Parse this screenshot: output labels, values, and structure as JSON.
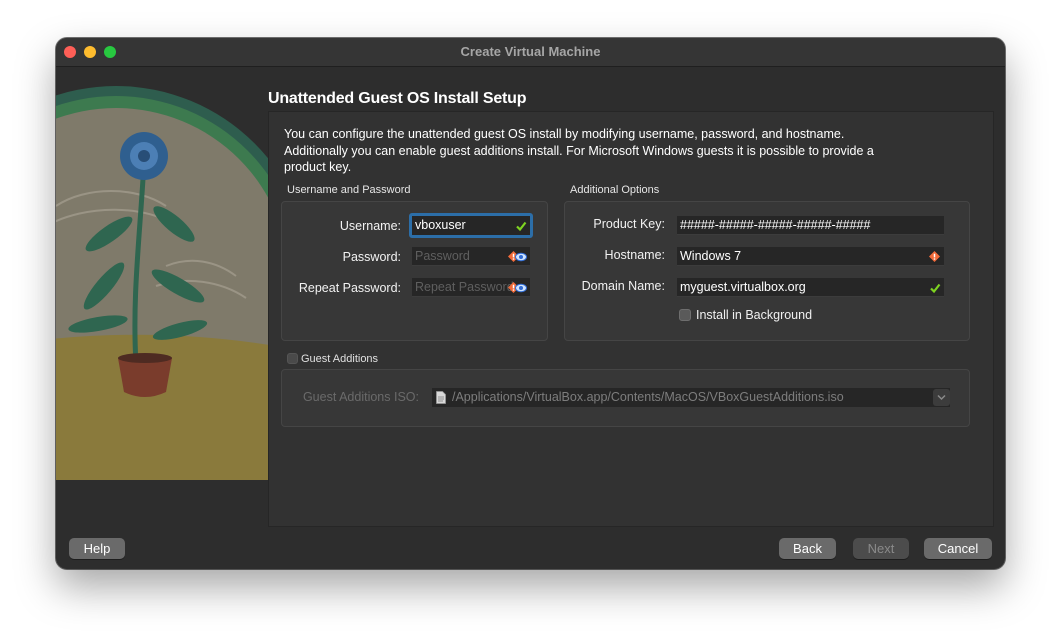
{
  "window": {
    "title": "Create Virtual Machine"
  },
  "page": {
    "title": "Unattended Guest OS Install Setup",
    "description": "You can configure the unattended guest OS install by modifying username, password, and hostname. Additionally you can enable guest additions install. For Microsoft Windows guests it is possible to provide a product key."
  },
  "credentials": {
    "group_label": "Username and Password",
    "username_label": "Username:",
    "username_value": "vboxuser",
    "password_label": "Password:",
    "password_placeholder": "Password",
    "repeat_label": "Repeat Password:",
    "repeat_placeholder": "Repeat Password"
  },
  "options": {
    "group_label": "Additional Options",
    "product_key_label": "Product Key:",
    "product_key_value": "#####-#####-#####-#####-#####",
    "hostname_label": "Hostname:",
    "hostname_value": "Windows 7",
    "domain_label": "Domain Name:",
    "domain_value": "myguest.virtualbox.org",
    "install_bg_label": "Install in Background"
  },
  "guest_additions": {
    "label": "Guest Additions",
    "iso_label": "Guest Additions ISO:",
    "iso_path": "/Applications/VirtualBox.app/Contents/MacOS/VBoxGuestAdditions.iso"
  },
  "buttons": {
    "help": "Help",
    "back": "Back",
    "next": "Next",
    "cancel": "Cancel"
  },
  "colors": {
    "valid_green": "#7ed321",
    "warning_orange": "#f26b3a",
    "focus_blue": "#2c6ea8"
  },
  "icons": [
    "valid-check-icon",
    "warning-icon",
    "show-password-eye-icon",
    "file-icon",
    "chevron-down-icon"
  ]
}
